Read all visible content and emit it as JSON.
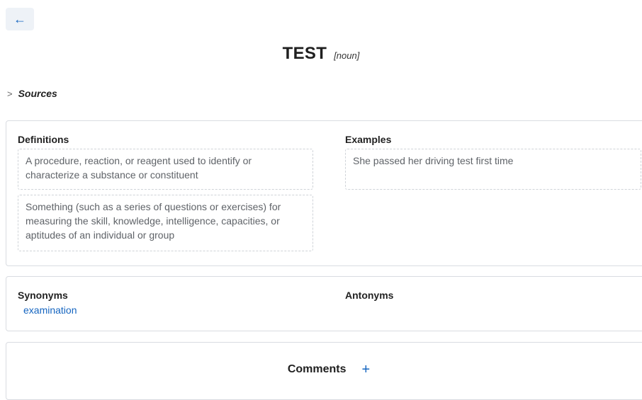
{
  "header": {
    "back_icon": "arrow-left-icon",
    "back_glyph": "←",
    "word": "TEST",
    "part_of_speech": "[noun]"
  },
  "sources": {
    "chevron_glyph": ">",
    "label": "Sources"
  },
  "definitions_section": {
    "title": "Definitions",
    "items": [
      "A procedure, reaction, or reagent used to identify or characterize a substance or constituent",
      "Something (such as a series of questions or exercises) for measuring the skill, knowledge, intelligence, capacities, or aptitudes of an individual or group"
    ]
  },
  "examples_section": {
    "title": "Examples",
    "items": [
      "She passed her driving test first time"
    ]
  },
  "synonyms_section": {
    "title": "Synonyms",
    "items": [
      "examination"
    ]
  },
  "antonyms_section": {
    "title": "Antonyms",
    "items": []
  },
  "comments": {
    "label": "Comments",
    "add_glyph": "+"
  },
  "colors": {
    "accent": "#1565c0",
    "border": "#d9dce1"
  }
}
